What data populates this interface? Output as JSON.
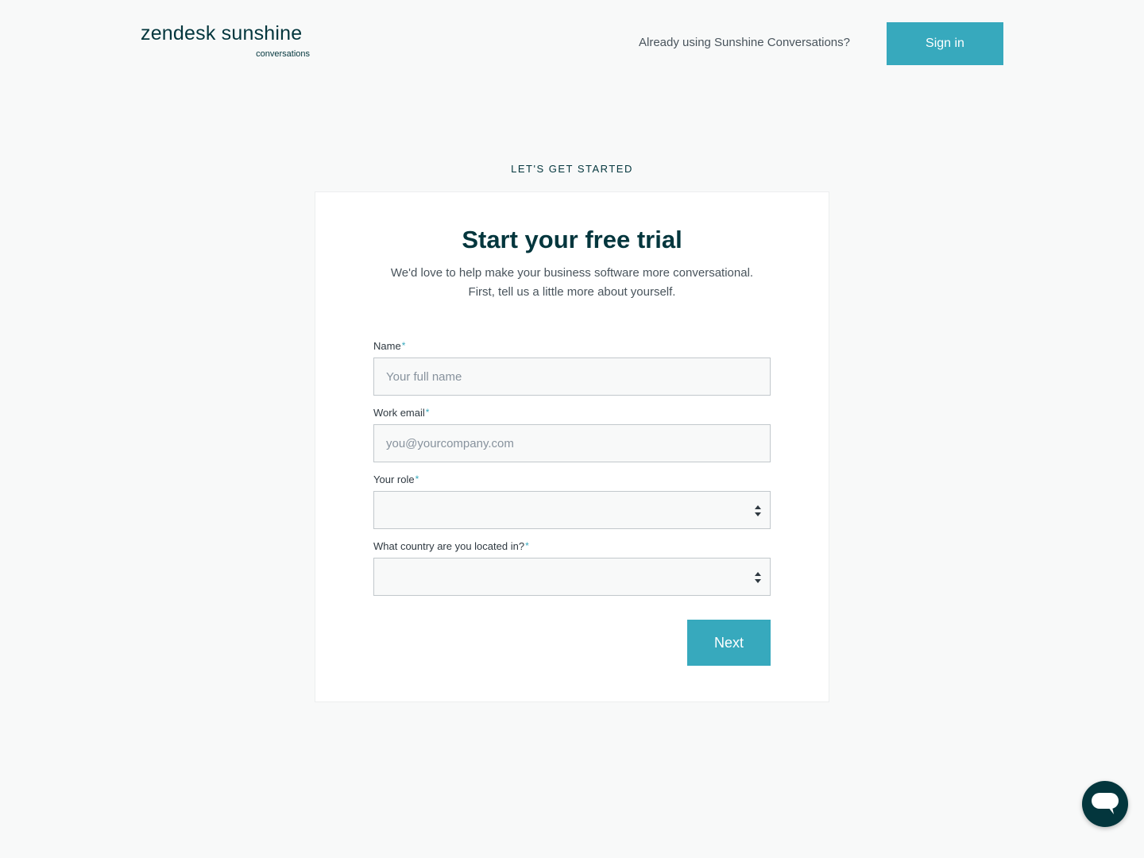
{
  "header": {
    "logo_main": "zendesk sunshine",
    "logo_sub": "conversations",
    "question": "Already using Sunshine Conversations?",
    "signin_label": "Sign in"
  },
  "eyebrow": "LET'S GET STARTED",
  "card": {
    "title": "Start your free trial",
    "subtitle_line1": "We'd love to help make your business software more conversational.",
    "subtitle_line2": "First, tell us a little more about yourself.",
    "required_mark": "*",
    "fields": {
      "name": {
        "label": "Name",
        "placeholder": "Your full name",
        "value": ""
      },
      "email": {
        "label": "Work email",
        "placeholder": "you@yourcompany.com",
        "value": ""
      },
      "role": {
        "label": "Your role",
        "selected": ""
      },
      "country": {
        "label": "What country are you located in?",
        "selected": ""
      }
    },
    "next_label": "Next"
  },
  "icons": {
    "select_arrows": "up-down-arrows-icon",
    "chat": "chat-bubble-icon"
  },
  "colors": {
    "accent": "#37a9bd",
    "brand_dark": "#03363d",
    "background": "#f8f9f9"
  }
}
